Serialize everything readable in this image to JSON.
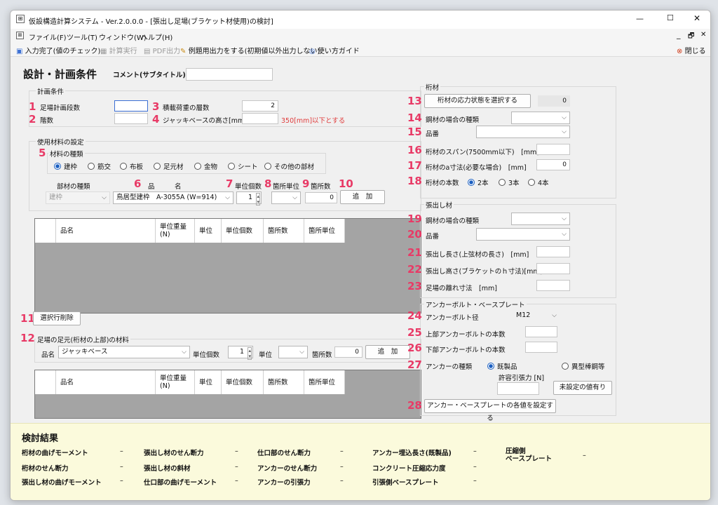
{
  "window": {
    "title": "仮設構造計算システム - Ver.2.0.0.0 - [張出し足場(ブラケット材使用)の検討]",
    "min": "—",
    "max": "☐",
    "close": "✕",
    "sub_min": "_",
    "sub_restore": "🗗",
    "sub_close": "✕"
  },
  "menu": [
    "ファイル(F)",
    "ツール(T)",
    "ウィンドウ(W)",
    "ヘルプ(H)"
  ],
  "toolbar": {
    "input_done": "入力完了(値のチェック)",
    "calc": "計算実行",
    "pdf": "PDF出力",
    "example": "例題用出力をする(初期値以外出力しない)",
    "howto": "使い方ガイド",
    "close": "閉じる"
  },
  "header": {
    "title": "設計・計画条件",
    "comment_label": "コメント(サブタイトル)",
    "comment_value": ""
  },
  "plan": {
    "group": "計画条件",
    "steps_label": "足場計画段数",
    "steps_value": "",
    "floors_label": "階数",
    "floors_value": "",
    "load_floors_label": "積載荷重の層数",
    "load_floors_value": "2",
    "jack_label": "ジャッキベースの高さ[mm]",
    "jack_value": "",
    "jack_note": "350[mm]以下とする"
  },
  "materials": {
    "group": "使用材料の設定",
    "kind_group": "材料の種類",
    "kinds": [
      "建枠",
      "筋交",
      "布板",
      "足元材",
      "金物",
      "シート",
      "その他の部材"
    ],
    "selected": "建枠",
    "part_kind_label": "部材の種類",
    "part_kind_value": "建枠",
    "hin_label": "品　　　名",
    "hin_value": "鳥居型建枠　A-3055A (W=914)",
    "unit_count_label": "単位個数",
    "unit_count_value": "1",
    "place_unit_label": "箇所単位",
    "place_unit_value": "",
    "places_label": "箇所数",
    "places_value": "0",
    "add_button": "追　加"
  },
  "table_cols": [
    "品名",
    "単位重量(N)",
    "単位",
    "単位個数",
    "箇所数",
    "箇所単位"
  ],
  "delete_button": "選択行削除",
  "foot": {
    "group": "足場の足元(桁材の上部)の材料",
    "name_label": "品名",
    "name_value": "ジャッキベース",
    "unit_count_label": "単位個数",
    "unit_count_value": "1",
    "unit_label": "単位",
    "unit_value": "",
    "places_label": "箇所数",
    "places_value": "0",
    "add_button": "追　加"
  },
  "keta": {
    "group": "桁材",
    "stress_button": "桁材の応力状態を選択する",
    "stress_value": "0",
    "steel_label": "鋼材の場合の種類",
    "steel_value": "",
    "part_label": "品番",
    "part_value": "",
    "span_label": "桁材のスパン(7500mm以下)　[mm]",
    "span_value": "",
    "a_label": "桁材のa寸法(必要な場合)　[mm]",
    "a_value": "0",
    "count_label": "桁材の本数",
    "counts": [
      "2本",
      "3本",
      "4本"
    ],
    "count_selected": "2本"
  },
  "hari": {
    "group": "張出し材",
    "steel_label": "鋼材の場合の種類",
    "steel_value": "",
    "part_label": "品番",
    "part_value": "",
    "len_label": "張出し長さ(上弦材の長さ)　[mm]",
    "len_value": "",
    "height_label": "張出し高さ(ブラケットのｈ寸法)[mm]",
    "height_value": "",
    "gap_label": "足場の離れ寸法　[mm]",
    "gap_value": ""
  },
  "anchor": {
    "group": "アンカーボルト・ベースプレート",
    "dia_label": "アンカーボルト径",
    "dia_value": "M12",
    "upper_label": "上部アンカーボルトの本数",
    "upper_value": "",
    "lower_label": "下部アンカーボルトの本数",
    "lower_value": "",
    "type_label": "アンカーの種類",
    "types": [
      "既製品",
      "異型棒鋼等"
    ],
    "type_selected": "既製品",
    "allow_label": "許容引張力 [N]",
    "allow_value": "",
    "unset_button": "未設定の値有り",
    "set_button": "アンカー・ベースプレートの各値を設定する"
  },
  "numbers": [
    "1",
    "2",
    "3",
    "4",
    "5",
    "6",
    "7",
    "8",
    "9",
    "10",
    "11",
    "12",
    "13",
    "14",
    "15",
    "16",
    "17",
    "18",
    "19",
    "20",
    "21",
    "22",
    "23",
    "24",
    "25",
    "26",
    "27",
    "28"
  ],
  "results": {
    "title": "検討結果",
    "rows": [
      [
        {
          "l": "桁材の曲げモーメント",
          "v": "–"
        },
        {
          "l": "張出し材のせん断力",
          "v": "–"
        },
        {
          "l": "仕口部のせん断力",
          "v": "–"
        },
        {
          "l": "アンカー埋込長さ(既製品)",
          "v": "–"
        },
        {
          "l": "圧縮側\nベースプレート",
          "v": "–"
        }
      ],
      [
        {
          "l": "桁材のせん断力",
          "v": "–"
        },
        {
          "l": "張出し材の斜材",
          "v": "–"
        },
        {
          "l": "アンカーのせん断力",
          "v": "–"
        },
        {
          "l": "コンクリート圧縮応力度",
          "v": "–"
        }
      ],
      [
        {
          "l": "張出し材の曲げモーメント",
          "v": "–"
        },
        {
          "l": "仕口部の曲げモーメント",
          "v": "–"
        },
        {
          "l": "アンカーの引張力",
          "v": "–"
        },
        {
          "l": "引張側ベースプレート",
          "v": "–"
        }
      ]
    ]
  }
}
